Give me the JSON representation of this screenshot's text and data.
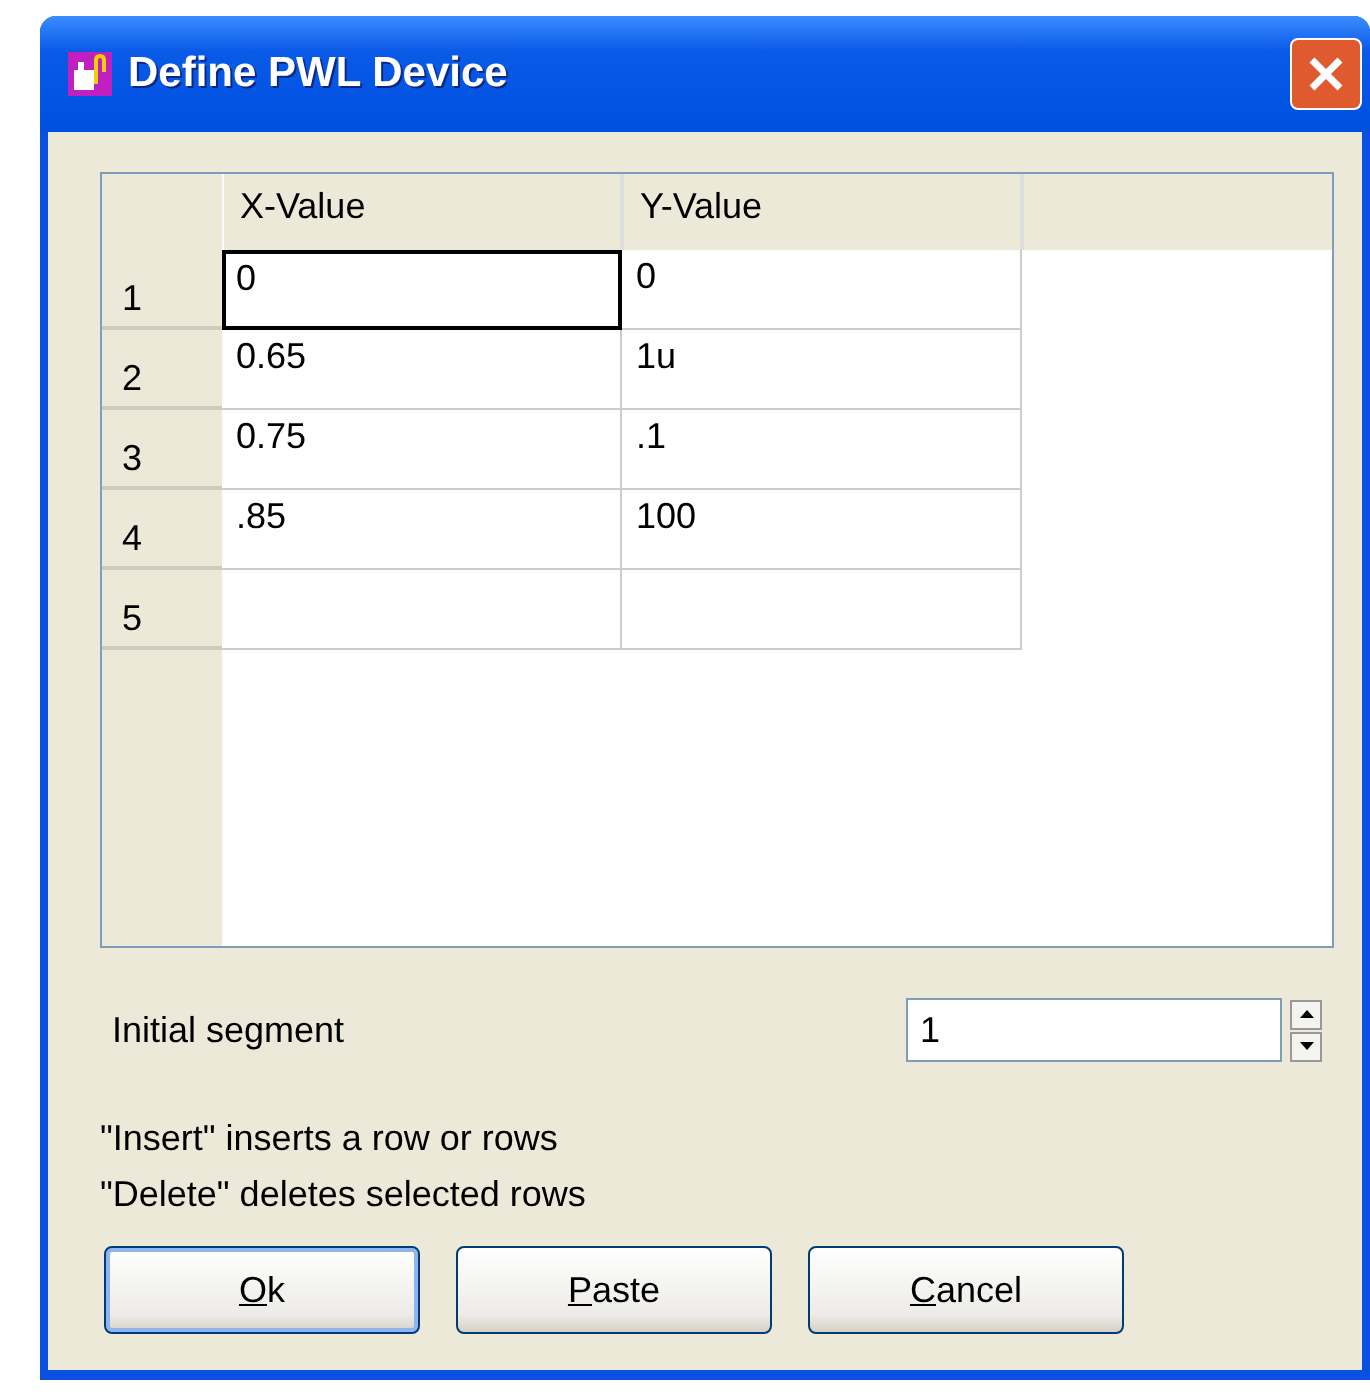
{
  "window": {
    "title": "Define PWL Device"
  },
  "grid": {
    "columns": [
      "X-Value",
      "Y-Value"
    ],
    "rows": [
      {
        "header": "1",
        "cells": [
          {
            "value": "0",
            "focused": true
          },
          {
            "value": "0",
            "focused": false
          }
        ]
      },
      {
        "header": "2",
        "cells": [
          {
            "value": "0.65",
            "focused": false
          },
          {
            "value": "1u",
            "focused": false
          }
        ]
      },
      {
        "header": "3",
        "cells": [
          {
            "value": "0.75",
            "focused": false
          },
          {
            "value": ".1",
            "focused": false
          }
        ]
      },
      {
        "header": "4",
        "cells": [
          {
            "value": ".85",
            "focused": false
          },
          {
            "value": "100",
            "focused": false
          }
        ]
      },
      {
        "header": "5",
        "cells": [
          {
            "focused": false
          },
          {
            "focused": false
          }
        ]
      }
    ]
  },
  "initial_segment": {
    "label": "Initial segment",
    "value": "1"
  },
  "help_lines": [
    "\"Insert\" inserts a row or rows",
    "\"Delete\" deletes selected rows"
  ],
  "buttons": [
    {
      "mnemonic": "O",
      "rest": "k",
      "default": true
    },
    {
      "mnemonic": "P",
      "rest": "aste",
      "default": false
    },
    {
      "mnemonic": "C",
      "rest": "ancel",
      "default": false
    }
  ]
}
